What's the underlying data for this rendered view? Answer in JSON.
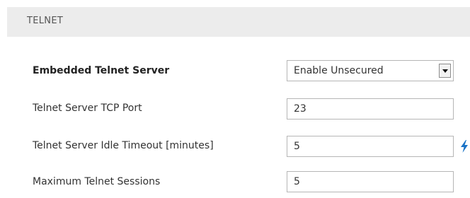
{
  "section": {
    "title": "TELNET"
  },
  "fields": {
    "embedded_server": {
      "label": "Embedded Telnet Server",
      "value": "Enable Unsecured"
    },
    "tcp_port": {
      "label": "Telnet Server TCP Port",
      "value": "23"
    },
    "idle_timeout": {
      "label": "Telnet Server Idle Timeout [minutes]",
      "value": "5",
      "indicator_icon": "lightning-bolt-icon",
      "indicator_color": "#1a73c7"
    },
    "max_sessions": {
      "label": "Maximum Telnet Sessions",
      "value": "5"
    }
  }
}
